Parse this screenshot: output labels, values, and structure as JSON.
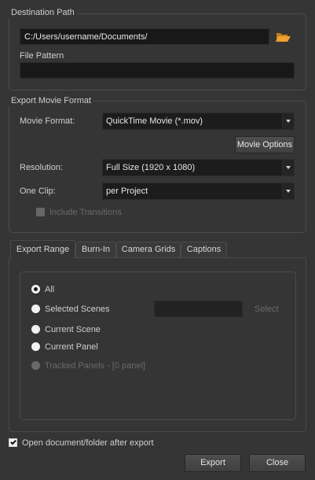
{
  "destination": {
    "group_title": "Destination Path",
    "path_value": "C:/Users/username/Documents/",
    "folder_icon": "folder-open-icon",
    "file_pattern_label": "File Pattern",
    "file_pattern_value": ""
  },
  "export_format": {
    "group_title": "Export Movie Format",
    "movie_format_label": "Movie Format:",
    "movie_format_value": "QuickTime Movie (*.mov)",
    "movie_options_button": "Movie Options",
    "resolution_label": "Resolution:",
    "resolution_value": "Full Size (1920 x 1080)",
    "one_clip_label": "One Clip:",
    "one_clip_value": "per Project",
    "include_transitions_label": "Include Transitions"
  },
  "tabs": [
    {
      "label": "Export Range",
      "active": true
    },
    {
      "label": "Burn-In",
      "active": false
    },
    {
      "label": "Camera Grids",
      "active": false
    },
    {
      "label": "Captions",
      "active": false
    }
  ],
  "export_range": {
    "options": [
      {
        "label": "All",
        "selected": true,
        "enabled": true
      },
      {
        "label": "Selected Scenes",
        "selected": false,
        "enabled": true
      },
      {
        "label": "Current Scene",
        "selected": false,
        "enabled": true
      },
      {
        "label": "Current Panel",
        "selected": false,
        "enabled": true
      },
      {
        "label": "Tracked Panels - [0 panel]",
        "selected": false,
        "enabled": false
      }
    ],
    "selected_scenes_value": "",
    "select_button": "Select"
  },
  "footer": {
    "open_after_export_label": "Open document/folder after export",
    "open_after_export_checked": true,
    "export_button": "Export",
    "close_button": "Close"
  },
  "colors": {
    "background": "#353535",
    "field": "#181818",
    "folder_icon": "#f0a030"
  }
}
